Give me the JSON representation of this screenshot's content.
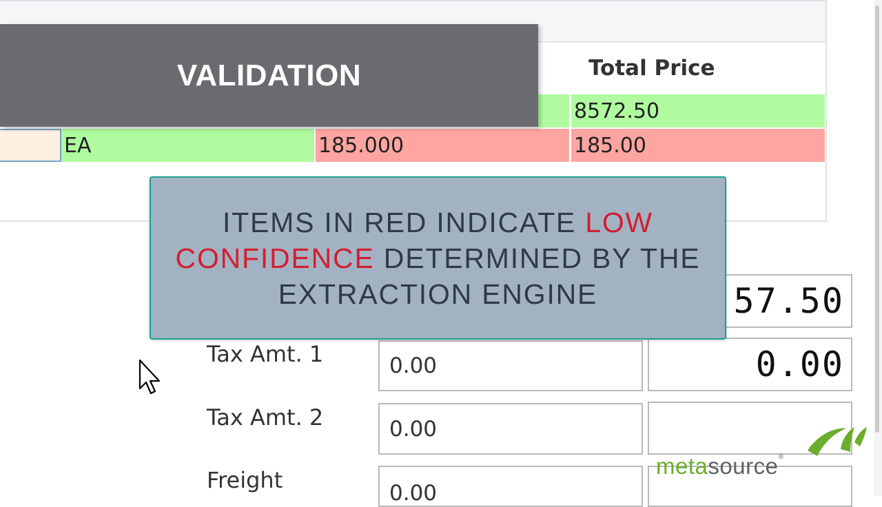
{
  "banner": {
    "title": "VALIDATION"
  },
  "grid": {
    "column_header": "Total Price",
    "rows": [
      {
        "unit": "",
        "unit_price": "",
        "total_price": "8572.50"
      },
      {
        "unit": "EA",
        "unit_price": "185.000",
        "total_price": "185.00"
      }
    ]
  },
  "callout": {
    "part1": "ITEMS IN RED INDICATE ",
    "highlight": "LOW CONFIDENCE",
    "part2": " DETERMINED BY THE EXTRACTION ENGINE"
  },
  "totals": [
    {
      "label": "",
      "value": "",
      "ocr": "57.50"
    },
    {
      "label": "Tax Amt. 1",
      "value": "0.00",
      "ocr": "0.00"
    },
    {
      "label": "Tax Amt. 2",
      "value": "0.00",
      "ocr": ""
    },
    {
      "label": "Freight",
      "value": "0.00",
      "ocr": ""
    }
  ],
  "logo": {
    "part1": "meta",
    "part2": "source",
    "tm": "®"
  },
  "colors": {
    "high_confidence": "#b0fba0",
    "low_confidence": "#fea5a1",
    "highlight": "#d11f2f",
    "banner": "#6b6b6f",
    "callout": "#a3b2c3"
  }
}
